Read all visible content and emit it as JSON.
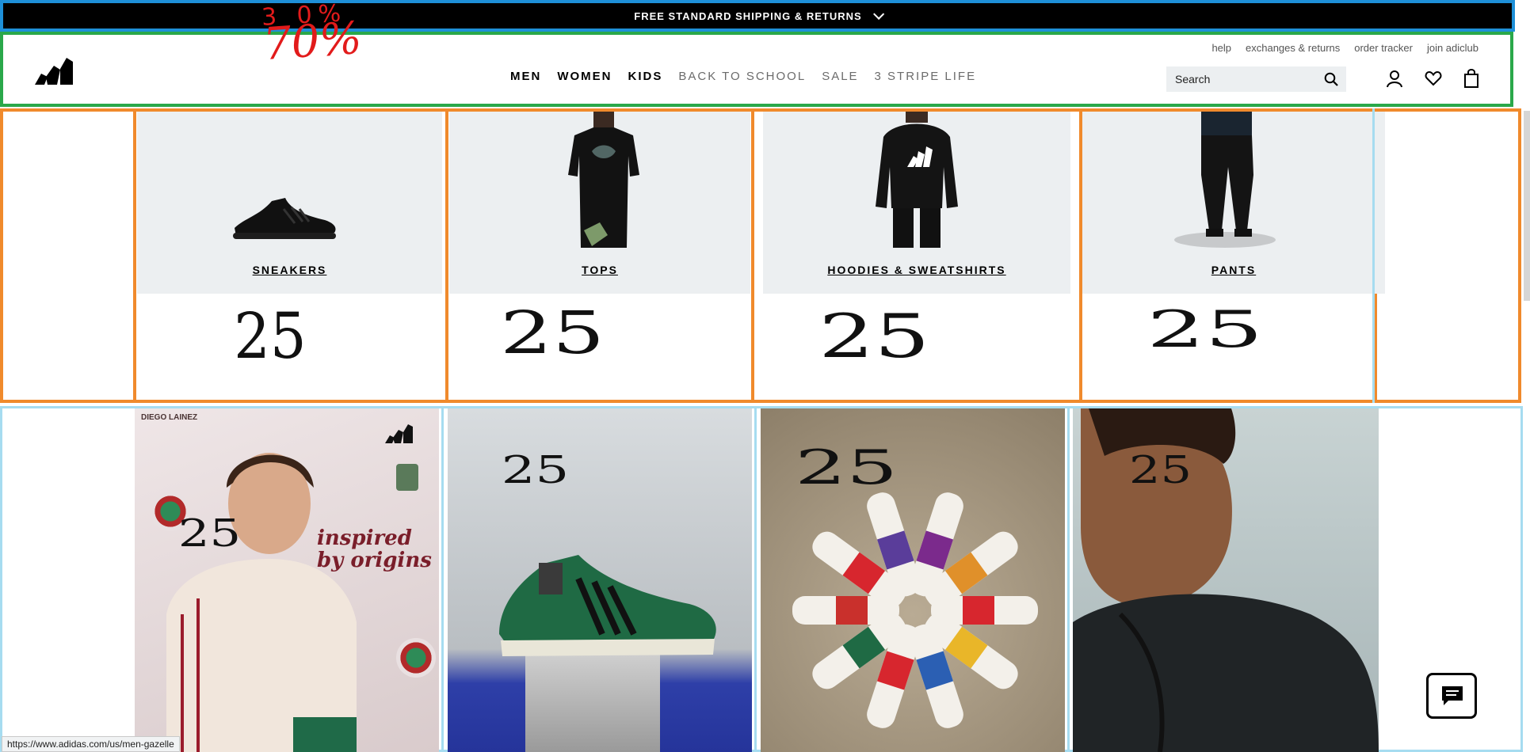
{
  "promo": {
    "text": "FREE STANDARD SHIPPING & RETURNS"
  },
  "annotations": {
    "header_top": "3 0%",
    "header_main": "70%",
    "tile": "25"
  },
  "header": {
    "util_links": [
      "help",
      "exchanges & returns",
      "order tracker",
      "join adiclub"
    ],
    "nav": [
      "MEN",
      "WOMEN",
      "KIDS",
      "BACK TO SCHOOL",
      "SALE",
      "3 STRIPE LIFE"
    ],
    "search_placeholder": "Search"
  },
  "categories": [
    {
      "label": "SNEAKERS"
    },
    {
      "label": "TOPS"
    },
    {
      "label": "HOODIES & SWEATSHIRTS"
    },
    {
      "label": "PANTS"
    }
  ],
  "hero": {
    "tile1_caption": "DIEGO LAINEZ",
    "tile1_headline_1": "inspired",
    "tile1_headline_2": "by origins"
  },
  "status_url": "https://www.adidas.com/us/men-gazelle",
  "colors": {
    "promo_bg": "#000000",
    "card_bg": "#eceff1",
    "annotation_red": "#e21b1b",
    "annotation_orange": "#f08a2c",
    "annotation_green": "#2aa84a",
    "annotation_blue": "#1e90d8",
    "annotation_lightblue": "#a6dcf0"
  }
}
